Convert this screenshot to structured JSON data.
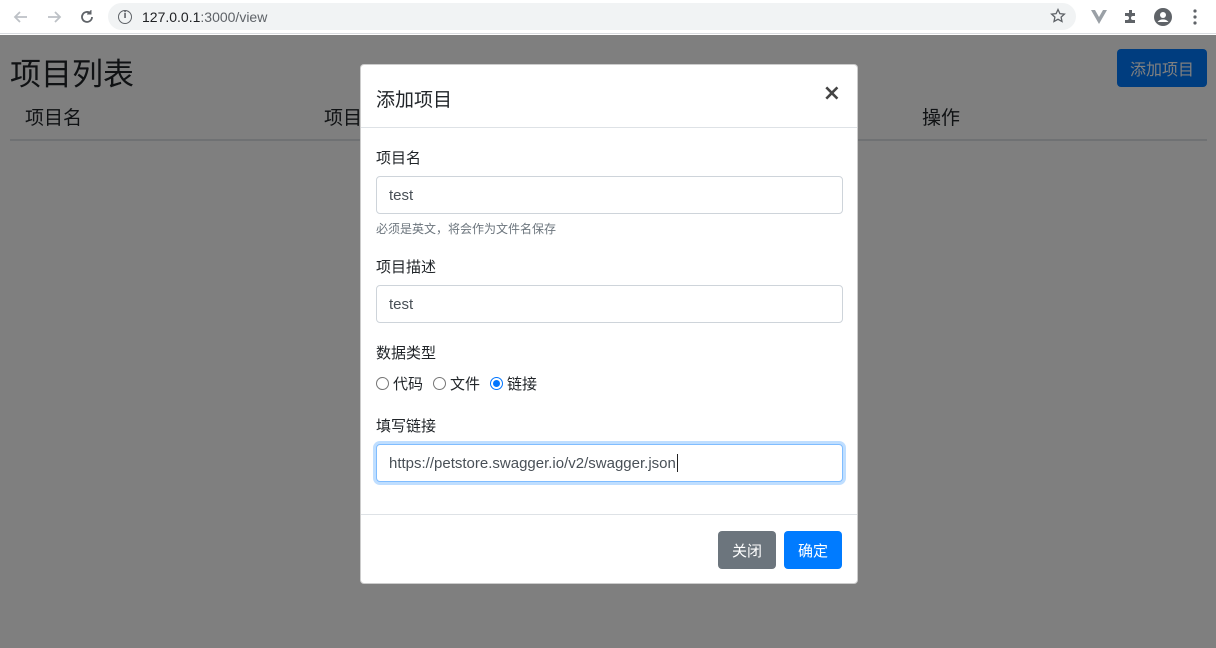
{
  "browser": {
    "url_host": "127.0.0.1",
    "url_path": ":3000/view"
  },
  "page": {
    "title": "项目列表",
    "add_button": "添加项目",
    "columns": [
      "项目名",
      "项目",
      "操作"
    ]
  },
  "modal": {
    "title": "添加项目",
    "close_symbol": "×",
    "fields": {
      "name_label": "项目名",
      "name_value": "test",
      "name_help": "必须是英文，将会作为文件名保存",
      "desc_label": "项目描述",
      "desc_value": "test",
      "type_label": "数据类型",
      "type_options": [
        "代码",
        "文件",
        "链接"
      ],
      "type_selected": "链接",
      "link_label": "填写链接",
      "link_value": "https://petstore.swagger.io/v2/swagger.json"
    },
    "footer": {
      "close_label": "关闭",
      "ok_label": "确定"
    }
  },
  "colors": {
    "primary": "#007bff",
    "secondary": "#6c757d"
  }
}
